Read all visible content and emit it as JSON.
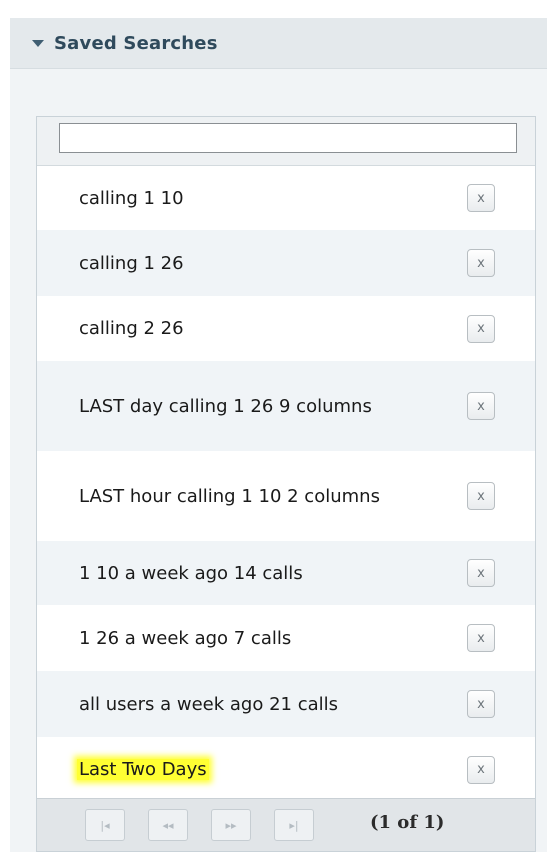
{
  "panel": {
    "title": "Saved Searches"
  },
  "filter": {
    "value": "",
    "placeholder": ""
  },
  "items": [
    {
      "label": "calling 1 10",
      "delete": "x"
    },
    {
      "label": "calling 1 26",
      "delete": "x"
    },
    {
      "label": "calling 2 26",
      "delete": "x"
    },
    {
      "label": "LAST day calling 1 26 9 columns",
      "delete": "x"
    },
    {
      "label": "LAST hour calling 1 10 2 columns",
      "delete": "x"
    },
    {
      "label": "1 10 a week ago 14 calls",
      "delete": "x"
    },
    {
      "label": "1 26 a week ago 7 calls",
      "delete": "x"
    },
    {
      "label": "all users a week ago 21 calls",
      "delete": "x"
    },
    {
      "label": "Last Two Days",
      "delete": "x",
      "highlighted": true
    }
  ],
  "pager": {
    "first": "|◂",
    "prev": "◂◂",
    "next": "▸▸",
    "last": "▸|",
    "info": "(1 of 1)"
  },
  "colors": {
    "header_bg": "#e4e9ec",
    "highlight": "#ffff33",
    "alt_row": "#f0f4f7"
  }
}
